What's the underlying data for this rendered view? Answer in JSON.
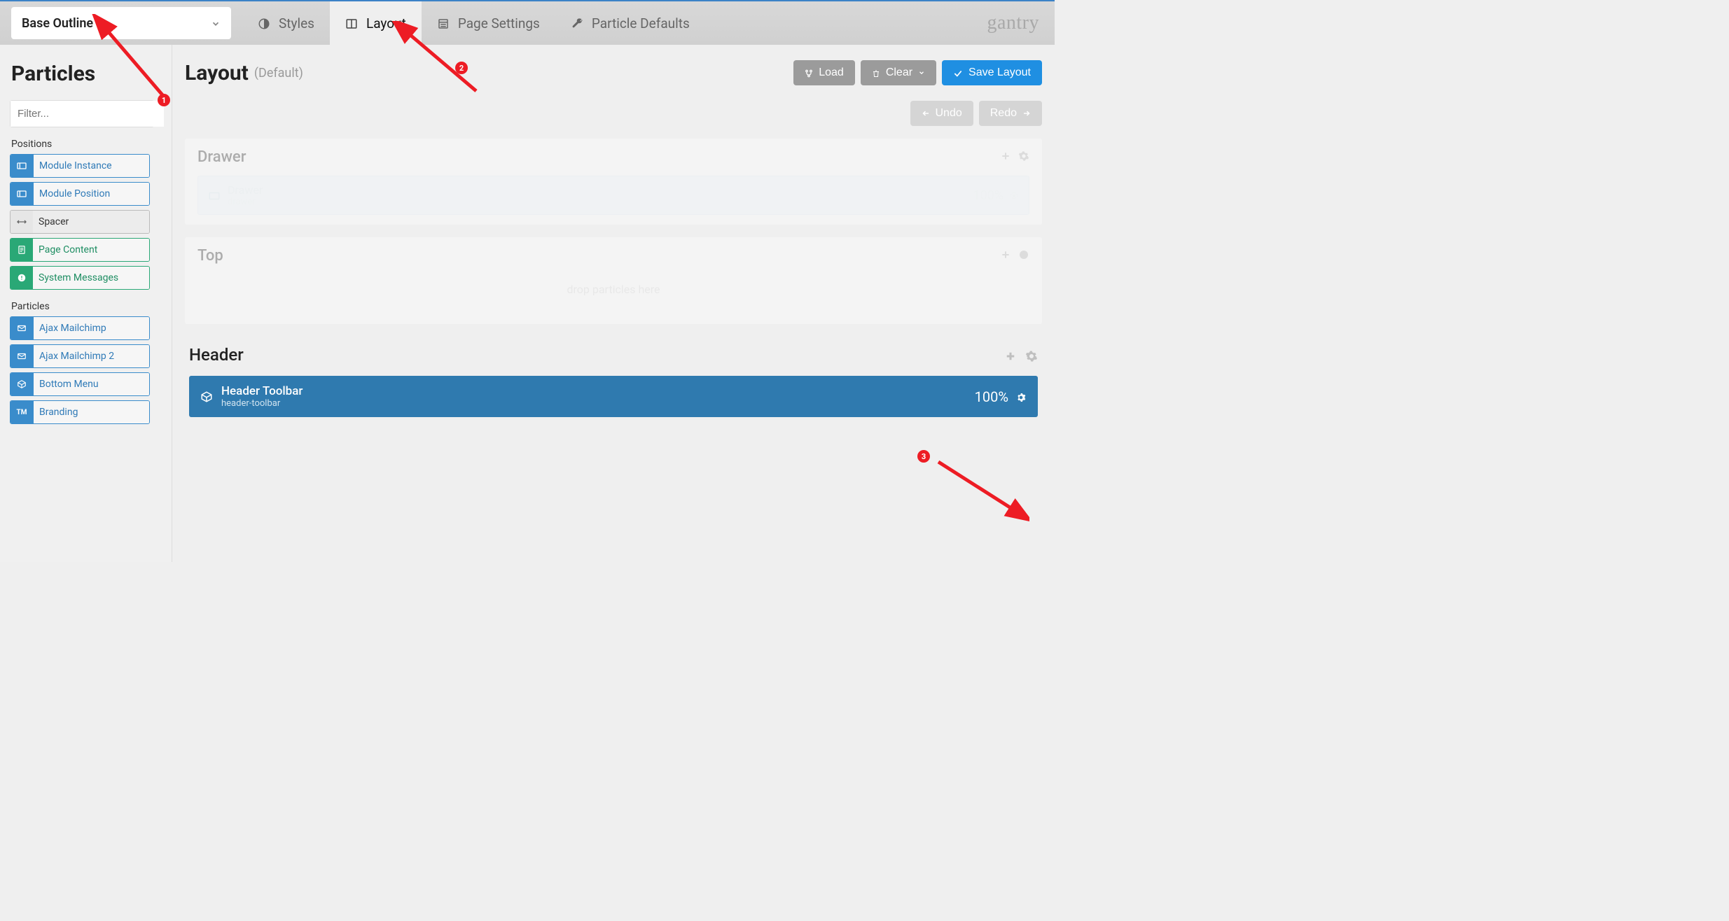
{
  "topbar": {
    "outline_selected": "Base Outline",
    "tabs": {
      "styles": "Styles",
      "layout": "Layout",
      "page_settings": "Page Settings",
      "particle_defaults": "Particle Defaults"
    },
    "logo": "gantry"
  },
  "sidebar": {
    "title": "Particles",
    "filter_placeholder": "Filter...",
    "groups": {
      "positions_label": "Positions",
      "positions": [
        {
          "label": "Module Instance"
        },
        {
          "label": "Module Position"
        },
        {
          "label": "Spacer"
        },
        {
          "label": "Page Content"
        },
        {
          "label": "System Messages"
        }
      ],
      "particles_label": "Particles",
      "particles": [
        {
          "label": "Ajax Mailchimp"
        },
        {
          "label": "Ajax Mailchimp 2"
        },
        {
          "label": "Bottom Menu"
        },
        {
          "label": "Branding"
        }
      ]
    }
  },
  "content": {
    "title": "Layout",
    "title_sub": "(Default)",
    "buttons": {
      "load": "Load",
      "clear": "Clear",
      "save": "Save Layout",
      "undo": "Undo",
      "redo": "Redo"
    },
    "sections": {
      "drawer": {
        "title": "Drawer",
        "slot_title": "Drawer",
        "slot_key": "drawer",
        "pct": "100%"
      },
      "top": {
        "title": "Top",
        "dropzone": "drop particles here"
      },
      "header": {
        "title": "Header",
        "slot_title": "Header Toolbar",
        "slot_key": "header-toolbar",
        "pct": "100%"
      }
    }
  },
  "annotations": {
    "b1": "1",
    "b2": "2",
    "b3": "3"
  }
}
